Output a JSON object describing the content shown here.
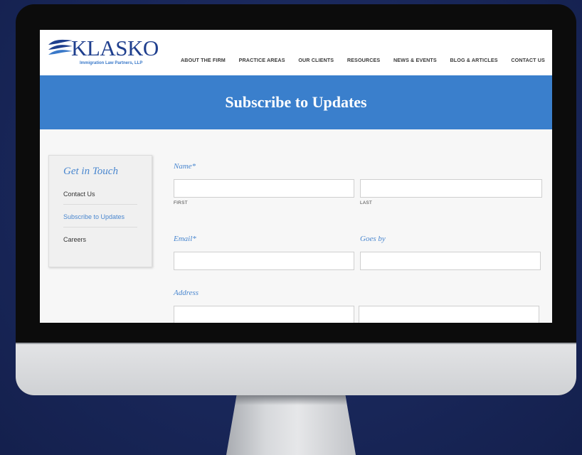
{
  "site": {
    "logo_text": "KLASKO",
    "logo_tagline": "Immigration Law Partners, LLP",
    "brand_color": "#3a7fcc"
  },
  "nav": {
    "items": [
      "ABOUT THE FIRM",
      "PRACTICE AREAS",
      "OUR CLIENTS",
      "RESOURCES",
      "NEWS & EVENTS",
      "BLOG & ARTICLES",
      "CONTACT US"
    ]
  },
  "banner": {
    "title": "Subscribe to Updates"
  },
  "sidebar": {
    "title": "Get in Touch",
    "links": [
      "Contact Us",
      "Subscribe to Updates",
      "Careers"
    ],
    "active_index": 1
  },
  "form": {
    "name_label": "Name*",
    "first_label": "FIRST",
    "last_label": "LAST",
    "email_label": "Email*",
    "goes_by_label": "Goes by",
    "address_label": "Address",
    "first_value": "",
    "last_value": "",
    "email_value": "",
    "goes_by_value": "",
    "address_line1_value": "",
    "address_line2_value": ""
  }
}
